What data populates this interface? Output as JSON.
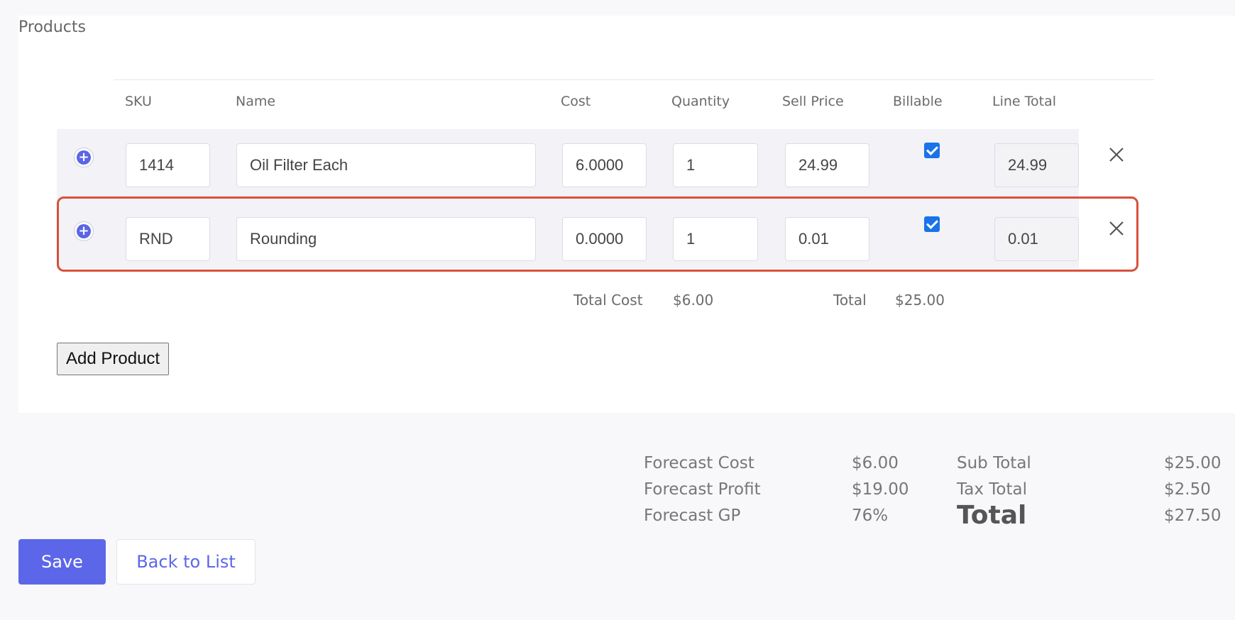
{
  "section_title": "Products",
  "columns": {
    "sku": "SKU",
    "name": "Name",
    "cost": "Cost",
    "quantity": "Quantity",
    "sell_price": "Sell Price",
    "billable": "Billable",
    "line_total": "Line Total"
  },
  "rows": [
    {
      "sku": "1414",
      "name": "Oil Filter Each",
      "cost": "6.0000",
      "quantity": "1",
      "sell_price": "24.99",
      "billable": true,
      "line_total": "24.99"
    },
    {
      "sku": "RND",
      "name": "Rounding",
      "cost": "0.0000",
      "quantity": "1",
      "sell_price": "0.01",
      "billable": true,
      "line_total": "0.01"
    }
  ],
  "table_totals": {
    "total_cost_label": "Total Cost",
    "total_cost_value": "$6.00",
    "total_label": "Total",
    "total_value": "$25.00"
  },
  "add_product_label": "Add Product",
  "forecast": {
    "cost_label": "Forecast Cost",
    "cost_value": "$6.00",
    "profit_label": "Forecast Profit",
    "profit_value": "$19.00",
    "gp_label": "Forecast GP",
    "gp_value": "76%"
  },
  "totals": {
    "sub_total_label": "Sub Total",
    "sub_total_value": "$25.00",
    "tax_total_label": "Tax Total",
    "tax_total_value": "$2.50",
    "total_label": "Total",
    "total_value": "$27.50"
  },
  "buttons": {
    "save": "Save",
    "back": "Back to List"
  },
  "colors": {
    "accent": "#5b67e8",
    "highlight": "#d8503a",
    "checkbox": "#1a73e8"
  }
}
